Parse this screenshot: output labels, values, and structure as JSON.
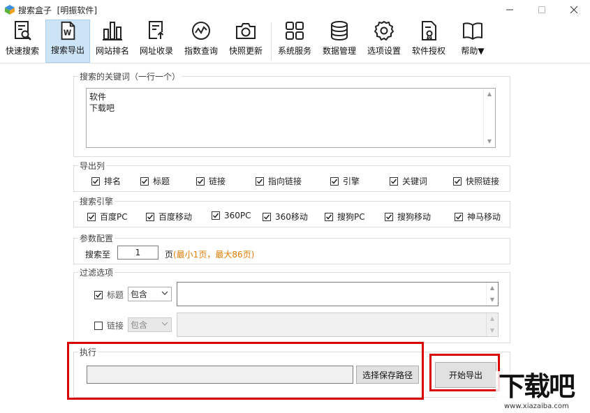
{
  "window": {
    "title": "搜索盒子",
    "subtitle": "[明振软件]"
  },
  "toolbar": {
    "items": [
      {
        "label": "快速搜索",
        "icon": "search-doc-icon"
      },
      {
        "label": "搜索导出",
        "icon": "word-export-icon",
        "active": true
      },
      {
        "label": "网站排名",
        "icon": "bar-chart-icon"
      },
      {
        "label": "网址收录",
        "icon": "doc-upload-icon"
      },
      {
        "label": "指数查询",
        "icon": "trend-icon"
      },
      {
        "label": "快照更新",
        "icon": "camera-icon"
      },
      {
        "label": "系统服务",
        "icon": "grid-icon"
      },
      {
        "label": "数据管理",
        "icon": "database-icon"
      },
      {
        "label": "选项设置",
        "icon": "gear-icon"
      },
      {
        "label": "软件授权",
        "icon": "license-icon"
      },
      {
        "label": "帮助▼",
        "icon": "book-icon"
      }
    ]
  },
  "keywords": {
    "title": "搜索的关键词（一行一个）",
    "lines": [
      "软件",
      "下载吧"
    ]
  },
  "export_cols": {
    "title": "导出列",
    "items": [
      {
        "label": "排名",
        "checked": true
      },
      {
        "label": "标题",
        "checked": true
      },
      {
        "label": "链接",
        "checked": true
      },
      {
        "label": "指向链接",
        "checked": true
      },
      {
        "label": "引擎",
        "checked": true
      },
      {
        "label": "关键词",
        "checked": true
      },
      {
        "label": "快照链接",
        "checked": true
      }
    ]
  },
  "engines": {
    "title": "搜索引擎",
    "items": [
      {
        "label": "百度PC",
        "checked": true
      },
      {
        "label": "百度移动",
        "checked": true
      },
      {
        "label": "360PC",
        "checked": true
      },
      {
        "label": "360移动",
        "checked": true
      },
      {
        "label": "搜狗PC",
        "checked": true
      },
      {
        "label": "搜狗移动",
        "checked": true
      },
      {
        "label": "神马移动",
        "checked": true
      }
    ]
  },
  "params": {
    "title": "参数配置",
    "search_to_label": "搜索至",
    "page_value": "1",
    "page_unit": "页",
    "hint": "(最小1页，最大86页)",
    "hint_color": "#e07b00"
  },
  "filter": {
    "title": "过滤选项",
    "rows": [
      {
        "label": "标题",
        "checked": true,
        "mode": "包含",
        "enabled": true
      },
      {
        "label": "链接",
        "checked": false,
        "mode": "包含",
        "enabled": false
      }
    ]
  },
  "execute": {
    "title": "执行",
    "path_value": "",
    "choose_path_label": "选择保存路径",
    "start_label": "开始导出"
  },
  "colors": {
    "highlight": "#d80000",
    "active_tab": "#cde4f7"
  },
  "watermark": {
    "text": "下载吧",
    "url": "www.xiazaiba.com"
  }
}
